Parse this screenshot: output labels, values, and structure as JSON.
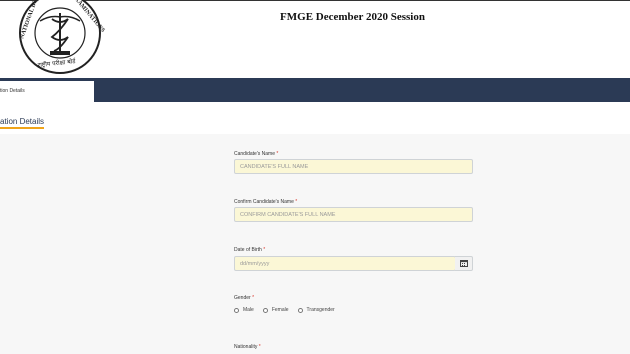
{
  "logo": {
    "text_top": "NATIONAL BOARD OF EXAMINATIONS",
    "text_bottom": "राष्ट्रीय परीक्षा बोर्ड"
  },
  "header": {
    "title": "FMGE December 2020 Session"
  },
  "nav": {
    "active_tab": "tion Details"
  },
  "section": {
    "title": "ation Details"
  },
  "form": {
    "candidate_name": {
      "label": "Candidate's Name",
      "required_mark": "*",
      "placeholder": "CANDIDATE'S FULL NAME"
    },
    "confirm_name": {
      "label": "Confirm Candidate's Name",
      "required_mark": "*",
      "placeholder": "CONFIRM CANDIDATE'S FULL NAME"
    },
    "dob": {
      "label": "Date of Birth",
      "required_mark": "*",
      "placeholder": "dd/mm/yyyy",
      "icon": "calendar-icon"
    },
    "gender": {
      "label": "Gender",
      "required_mark": "*",
      "options": [
        "Male",
        "Female",
        "Transgender"
      ]
    },
    "nationality": {
      "label": "Nationality",
      "required_mark": "*"
    }
  },
  "colors": {
    "navbar": "#2b3a55",
    "accent": "#f0a419",
    "input_bg": "#fbf7d6",
    "required": "#d9362b"
  }
}
